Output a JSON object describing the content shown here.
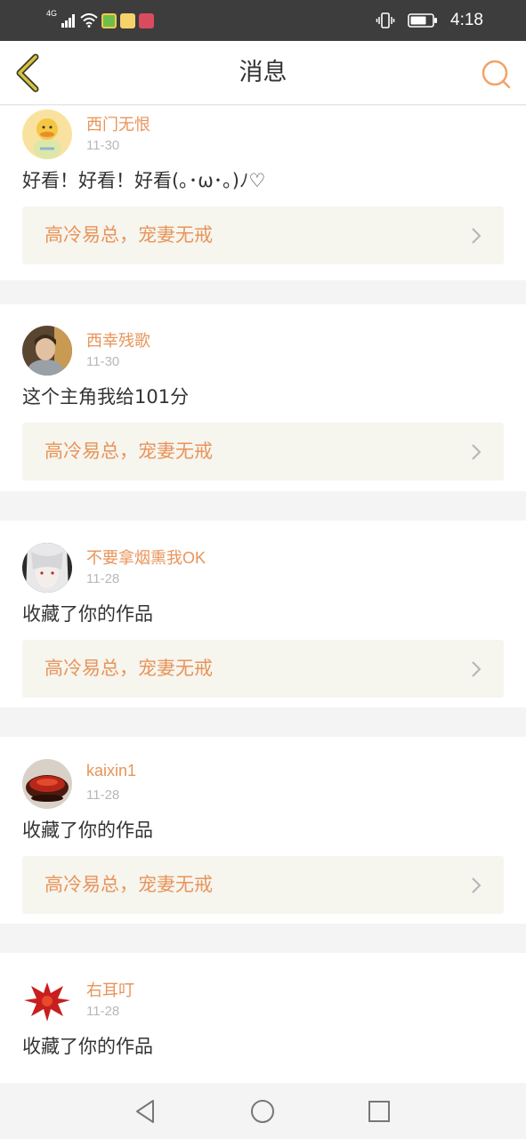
{
  "status_bar": {
    "network": "4G",
    "time": "4:18",
    "icons": [
      "signal-icon",
      "wifi-icon",
      "app-notification-icon",
      "app-notification-icon",
      "app-notification-icon",
      "vibrate-icon",
      "battery-icon"
    ]
  },
  "header": {
    "title": "消息",
    "back_icon": "chevron-left-icon",
    "search_icon": "search-icon"
  },
  "colors": {
    "accent": "#e8945a",
    "back_icon": "#c9b23a",
    "link_bg": "#f6f5ee",
    "status_bar_bg": "#3d3d3d"
  },
  "messages": [
    {
      "user": "西门无恨",
      "date": "11-30",
      "text": "好看！好看！好看(｡･ω･｡)ﾉ♡",
      "work": "高冷易总，宠妻无戒"
    },
    {
      "user": "西幸残歌",
      "date": "11-30",
      "text": "这个主角我给101分",
      "work": "高冷易总，宠妻无戒"
    },
    {
      "user": "不要拿烟熏我OK",
      "date": "11-28",
      "text": "收藏了你的作品",
      "work": "高冷易总，宠妻无戒"
    },
    {
      "user": "kaixin1",
      "date": "11-28",
      "text": "收藏了你的作品",
      "work": "高冷易总，宠妻无戒"
    },
    {
      "user": "右耳叮",
      "date": "11-28",
      "text": "收藏了你的作品",
      "work": ""
    }
  ],
  "nav_bar": {
    "icons": [
      "back-triangle-icon",
      "home-circle-icon",
      "recents-square-icon"
    ]
  }
}
